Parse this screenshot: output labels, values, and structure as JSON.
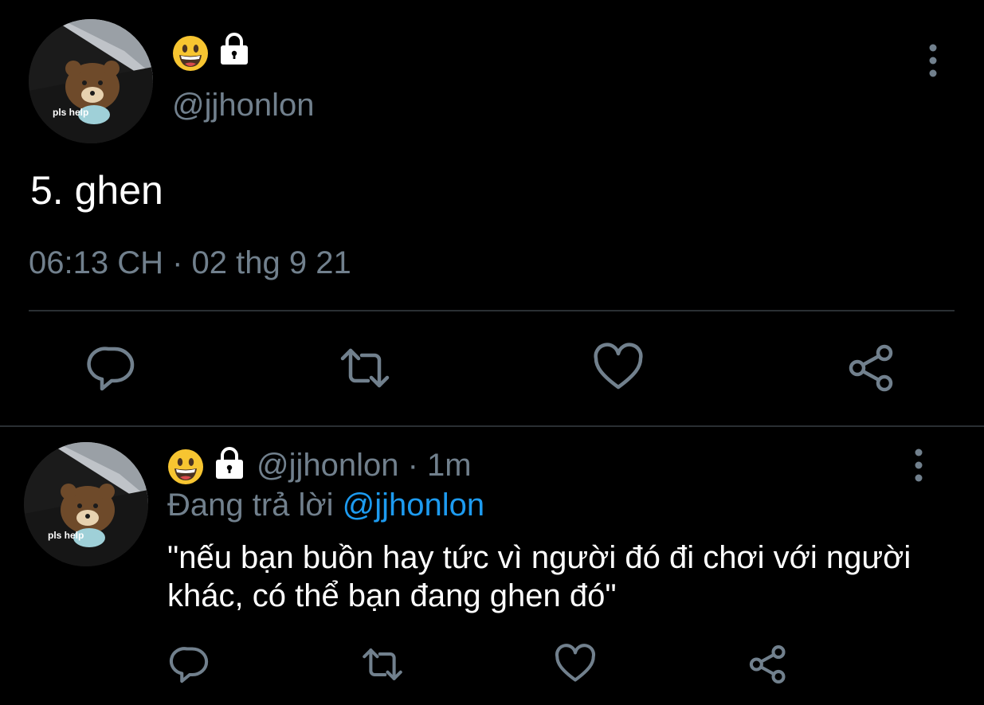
{
  "main_tweet": {
    "display_name_emoji": "😀",
    "protected_icon": "lock-icon",
    "handle": "@jjhonlon",
    "avatar_caption": "pls help",
    "text": "5. ghen",
    "timestamp": "06:13 CH · 02 thg 9 21",
    "actions": [
      "reply-icon",
      "retweet-icon",
      "like-icon",
      "share-icon"
    ]
  },
  "reply_tweet": {
    "display_name_emoji": "😀",
    "protected_icon": "lock-icon",
    "handle_time": "@jjhonlon · 1m",
    "avatar_caption": "pls help",
    "replying_to_prefix": "Đang trả lời ",
    "replying_to_mention": "@jjhonlon",
    "text": "\"nếu bạn buồn hay tức vì người đó đi chơi với người khác, có thể bạn đang ghen đó\"",
    "actions": [
      "reply-icon",
      "retweet-icon",
      "like-icon",
      "share-icon"
    ]
  },
  "colors": {
    "background": "#000000",
    "primary_text": "#ffffff",
    "secondary_text": "#71808d",
    "mention": "#1d9bf0",
    "divider": "#2a2f33"
  }
}
